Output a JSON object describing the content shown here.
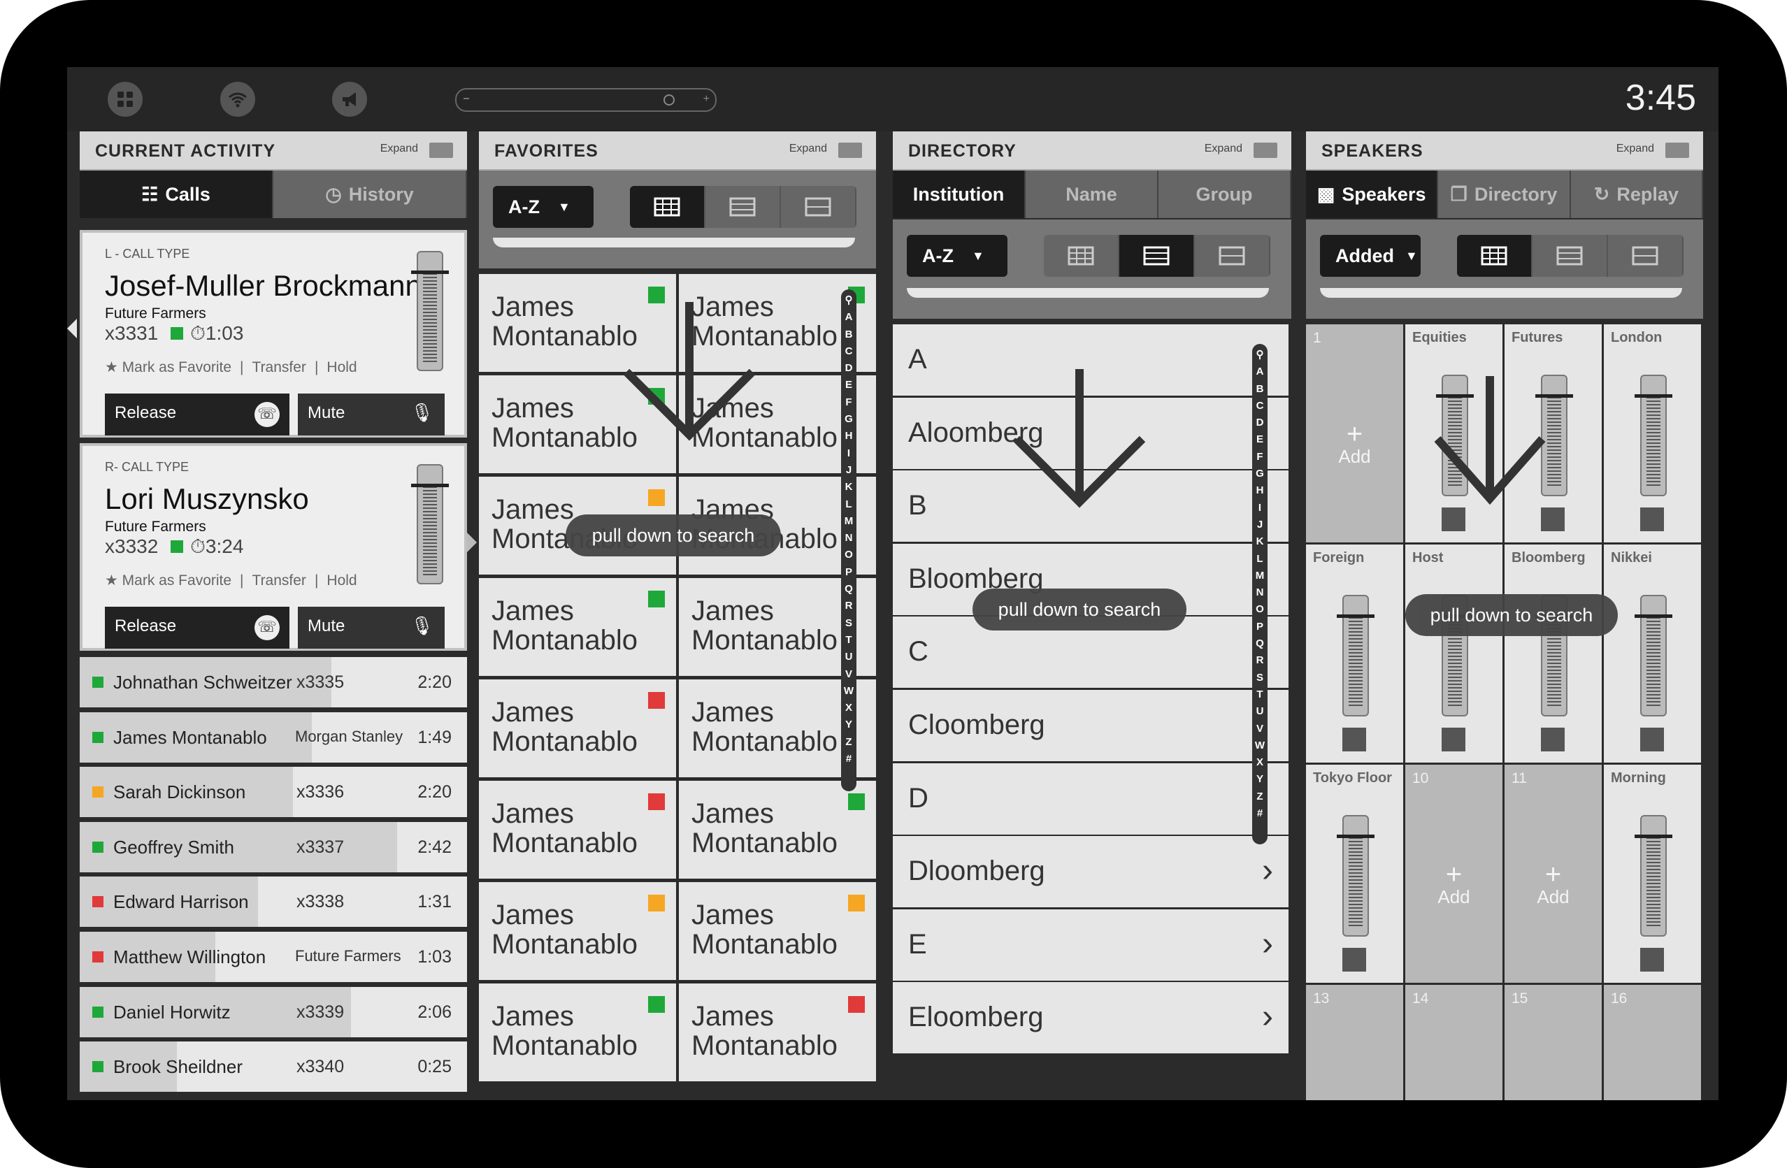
{
  "topbar": {
    "time": "3:45",
    "icons": [
      "apps-icon",
      "wifi-icon",
      "megaphone-icon"
    ]
  },
  "activity": {
    "title": "CURRENT ACTIVITY",
    "expand": "Expand",
    "tabs": [
      "Calls",
      "History"
    ],
    "cards": [
      {
        "type": "L - CALL TYPE",
        "name": "Josef-Muller Brockmann",
        "org": "Future Farmers",
        "ext": "x3331",
        "timer": "1:03",
        "fav": "Mark as Favorite",
        "transfer": "Transfer",
        "hold": "Hold",
        "release": "Release",
        "mute": "Mute"
      },
      {
        "type": "R- CALL TYPE",
        "name": "Lori Muszynsko",
        "org": "Future Farmers",
        "ext": "x3332",
        "timer": "3:24",
        "fav": "Mark as Favorite",
        "transfer": "Transfer",
        "hold": "Hold",
        "release": "Release",
        "mute": "Mute"
      }
    ],
    "rows": [
      {
        "name": "Johnathan Schweitzer",
        "ext": "x3335",
        "time": "2:20",
        "color": "#1fa83a",
        "fill": 0.65
      },
      {
        "name": "James Montanablo",
        "ext": "Morgan Stanley",
        "time": "1:49",
        "color": "#1fa83a",
        "fill": 0.6
      },
      {
        "name": "Sarah Dickinson",
        "ext": "x3336",
        "time": "2:20",
        "color": "#f5a623",
        "fill": 0.55
      },
      {
        "name": "Geoffrey Smith",
        "ext": "x3337",
        "time": "2:42",
        "color": "#1fa83a",
        "fill": 0.82
      },
      {
        "name": "Edward Harrison",
        "ext": "x3338",
        "time": "1:31",
        "color": "#e03a3a",
        "fill": 0.46
      },
      {
        "name": "Matthew Willington",
        "ext": "Future Farmers",
        "time": "1:03",
        "color": "#e03a3a",
        "fill": 0.35
      },
      {
        "name": "Daniel Horwitz",
        "ext": "x3339",
        "time": "2:06",
        "color": "#1fa83a",
        "fill": 0.7
      },
      {
        "name": "Brook Sheildner",
        "ext": "x3340",
        "time": "0:25",
        "color": "#1fa83a",
        "fill": 0.25
      }
    ]
  },
  "favorites": {
    "title": "FAVORITES",
    "expand": "Expand",
    "sort": "A-Z",
    "pull": "pull down to search",
    "tile_first": "James",
    "tile_last": "Montanablo",
    "status": [
      "#1fa83a",
      "#1fa83a",
      "#1fa83a",
      "",
      "#f5a623",
      "",
      "#1fa83a",
      "",
      "#e03a3a",
      "",
      "#e03a3a",
      "#1fa83a",
      "#f5a623",
      "#f5a623",
      "#1fa83a",
      "#e03a3a"
    ],
    "alphabet": [
      "A",
      "B",
      "C",
      "D",
      "E",
      "F",
      "G",
      "H",
      "I",
      "J",
      "K",
      "L",
      "M",
      "N",
      "O",
      "P",
      "Q",
      "R",
      "S",
      "T",
      "U",
      "V",
      "W",
      "X",
      "Y",
      "Z",
      "#"
    ]
  },
  "directory": {
    "title": "DIRECTORY",
    "expand": "Expand",
    "tabs": [
      "Institution",
      "Name",
      "Group"
    ],
    "sort": "A-Z",
    "pull": "pull down to search",
    "rows": [
      "A",
      "Aloomberg",
      "B",
      "Bloomberg",
      "C",
      "Cloomberg",
      "D",
      "Dloomberg",
      "E",
      "Eloomberg"
    ]
  },
  "speakers": {
    "title": "SPEAKERS",
    "expand": "Expand",
    "tabs": [
      "Speakers",
      "Directory",
      "Replay"
    ],
    "sort": "Added",
    "pull": "pull down to search",
    "add": "Add",
    "cells": [
      {
        "label": "1",
        "type": "empty"
      },
      {
        "label": "Equities",
        "type": "slider",
        "level": 0.85
      },
      {
        "label": "Futures",
        "type": "slider",
        "level": 0.85
      },
      {
        "label": "London",
        "type": "slider",
        "level": 0.85
      },
      {
        "label": "Foreign",
        "type": "slider",
        "level": 0.85
      },
      {
        "label": "Host",
        "type": "slider",
        "level": 0.85
      },
      {
        "label": "Bloomberg",
        "type": "slider",
        "level": 0.85
      },
      {
        "label": "Nikkei",
        "type": "slider",
        "level": 0.85
      },
      {
        "label": "Tokyo Floor",
        "type": "slider",
        "level": 0.85
      },
      {
        "label": "10",
        "type": "empty"
      },
      {
        "label": "11",
        "type": "empty"
      },
      {
        "label": "Morning",
        "type": "slider",
        "level": 0.85
      },
      {
        "label": "13",
        "type": "blank"
      },
      {
        "label": "14",
        "type": "blank"
      },
      {
        "label": "15",
        "type": "blank"
      },
      {
        "label": "16",
        "type": "blank"
      }
    ]
  },
  "colors": {
    "green": "#1fa83a",
    "orange": "#f5a623",
    "red": "#e03a3a"
  }
}
